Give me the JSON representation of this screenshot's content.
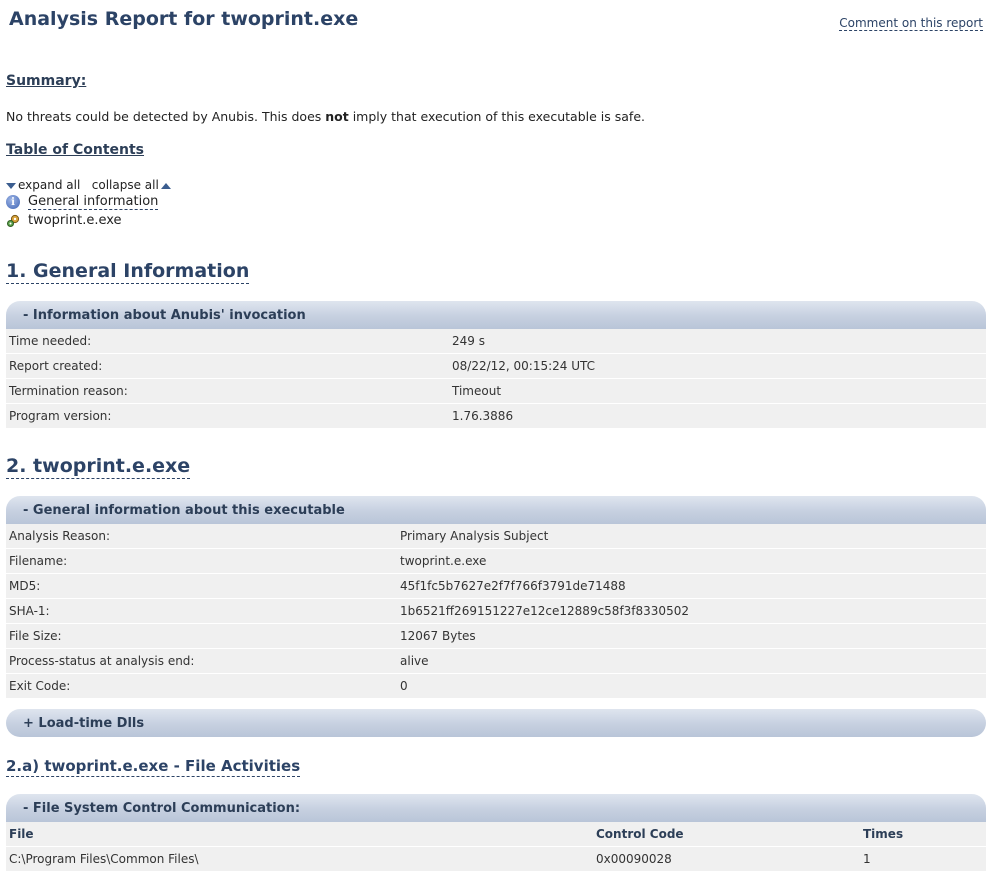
{
  "header": {
    "title": "Analysis Report for twoprint.exe",
    "comment_link": "Comment on this report"
  },
  "summary": {
    "heading": "Summary:",
    "text_before": "No threats could be detected by Anubis. This does ",
    "text_bold": "not",
    "text_after": " imply that execution of this executable is safe."
  },
  "toc": {
    "heading": "Table of Contents",
    "expand_all": "expand all",
    "collapse_all": "collapse all",
    "items": [
      {
        "label": "General information",
        "icon": "info-icon"
      },
      {
        "label": "twoprint.e.exe",
        "icon": "gear-icon"
      }
    ]
  },
  "section1": {
    "heading": "1. General Information",
    "panel_title": "- Information about Anubis' invocation",
    "rows": [
      {
        "label": "Time needed:",
        "value": "249 s"
      },
      {
        "label": "Report created:",
        "value": "08/22/12, 00:15:24 UTC"
      },
      {
        "label": "Termination reason:",
        "value": "Timeout"
      },
      {
        "label": "Program version:",
        "value": "1.76.3886"
      }
    ]
  },
  "section2": {
    "heading": "2. twoprint.e.exe",
    "panel_title": "- General information about this executable",
    "rows": [
      {
        "label": "Analysis Reason:",
        "value": "Primary Analysis Subject"
      },
      {
        "label": "Filename:",
        "value": "twoprint.e.exe"
      },
      {
        "label": "MD5:",
        "value": "45f1fc5b7627e2f7f766f3791de71488"
      },
      {
        "label": "SHA-1:",
        "value": "1b6521ff269151227e12ce12889c58f3f8330502"
      },
      {
        "label": "File Size:",
        "value": "12067 Bytes"
      },
      {
        "label": "Process-status at analysis end:",
        "value": "alive"
      },
      {
        "label": "Exit Code:",
        "value": "0"
      }
    ],
    "dlls_panel_title": "+ Load-time Dlls"
  },
  "section2a": {
    "heading": "2.a) twoprint.e.exe - File Activities",
    "panel_title": "- File System Control Communication:",
    "columns": [
      "File",
      "Control Code",
      "Times"
    ],
    "rows": [
      {
        "file": "C:\\Program Files\\Common Files\\",
        "control_code": "0x00090028",
        "times": "1"
      }
    ]
  },
  "colors": {
    "heading": "#2c4366",
    "panel_bar": "#c6d0e0",
    "row_bg": "#f0f0f0"
  }
}
